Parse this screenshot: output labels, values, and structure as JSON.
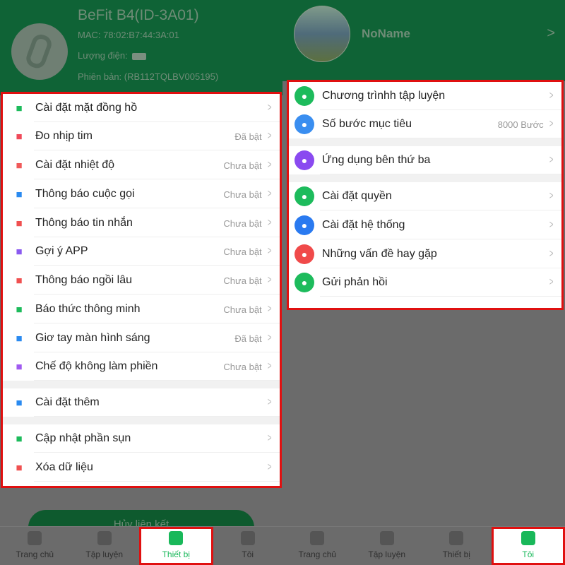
{
  "device": {
    "title": "BeFit B4(ID-3A01)",
    "mac": "MAC:  78:02:B7:44:3A:01",
    "battery_label": "Lượng điện:",
    "version": "Phiên bản:  (RB112TQLBV005195)"
  },
  "device_menu": [
    {
      "label": "Cài đặt mặt đồng hồ",
      "value": "",
      "icon": "watch-face-icon",
      "color": "#1dbb5c"
    },
    {
      "label": "Đo nhịp tim",
      "value": "Đã bật",
      "icon": "heart-rate-icon",
      "color": "#f04a5a"
    },
    {
      "label": "Cài đặt nhiệt độ",
      "value": "Chưa bật",
      "icon": "thermometer-icon",
      "color": "#f05a5a"
    },
    {
      "label": "Thông báo cuộc gọi",
      "value": "Chưa bật",
      "icon": "phone-icon",
      "color": "#2a8af0"
    },
    {
      "label": "Thông báo tin nhắn",
      "value": "Chưa bật",
      "icon": "message-icon",
      "color": "#f05050"
    },
    {
      "label": "Gợi ý APP",
      "value": "Chưa bật",
      "icon": "smartphone-icon",
      "color": "#8a5af0"
    },
    {
      "label": "Thông báo ngồi lâu",
      "value": "Chưa bật",
      "icon": "sofa-icon",
      "color": "#f05050"
    },
    {
      "label": "Báo thức thông minh",
      "value": "Chưa bật",
      "icon": "alarm-icon",
      "color": "#1dbb5c"
    },
    {
      "label": "Giơ tay màn hình sáng",
      "value": "Đã bật",
      "icon": "raise-wrist-icon",
      "color": "#2a8af0"
    },
    {
      "label": "Chế độ không làm phiền",
      "value": "Chưa bật",
      "icon": "bell-off-icon",
      "color": "#a05af0"
    },
    {
      "label": "Cài đặt thêm",
      "value": "",
      "icon": "gear-icon",
      "color": "#2a8af0"
    },
    {
      "label": "Cập nhật phần sụn",
      "value": "",
      "icon": "refresh-icon",
      "color": "#1dbb5c"
    },
    {
      "label": "Xóa dữ liệu",
      "value": "",
      "icon": "trash-icon",
      "color": "#f05050"
    }
  ],
  "disconnect_label": "Hủy liên kết",
  "profile": {
    "name": "NoName"
  },
  "me_menu": [
    {
      "label": "Chương trìnhh tập luyện",
      "value": "",
      "icon": "training-plan-icon",
      "color": "#1dbb5c"
    },
    {
      "label": "Số bước mục tiêu",
      "value": "8000 Bước",
      "icon": "target-icon",
      "color": "#3a8ef0"
    },
    {
      "label": "Ứng dụng bên thứ ba",
      "value": "",
      "icon": "apps-icon",
      "color": "#8a4af0"
    },
    {
      "label": "Cài đặt quyền",
      "value": "",
      "icon": "permission-gear-icon",
      "color": "#1dbb5c"
    },
    {
      "label": "Cài đặt hệ thống",
      "value": "",
      "icon": "system-gear-icon",
      "color": "#2a7af0"
    },
    {
      "label": "Những vấn đề hay gặp",
      "value": "",
      "icon": "question-icon",
      "color": "#f04a4a"
    },
    {
      "label": "Gửi phản hồi",
      "value": "",
      "icon": "feedback-icon",
      "color": "#1dbb5c"
    }
  ],
  "nav": [
    "Trang chủ",
    "Tập luyện",
    "Thiết bị",
    "Tôi"
  ],
  "colors": {
    "accent": "#19b85a",
    "highlight": "#e01010"
  }
}
